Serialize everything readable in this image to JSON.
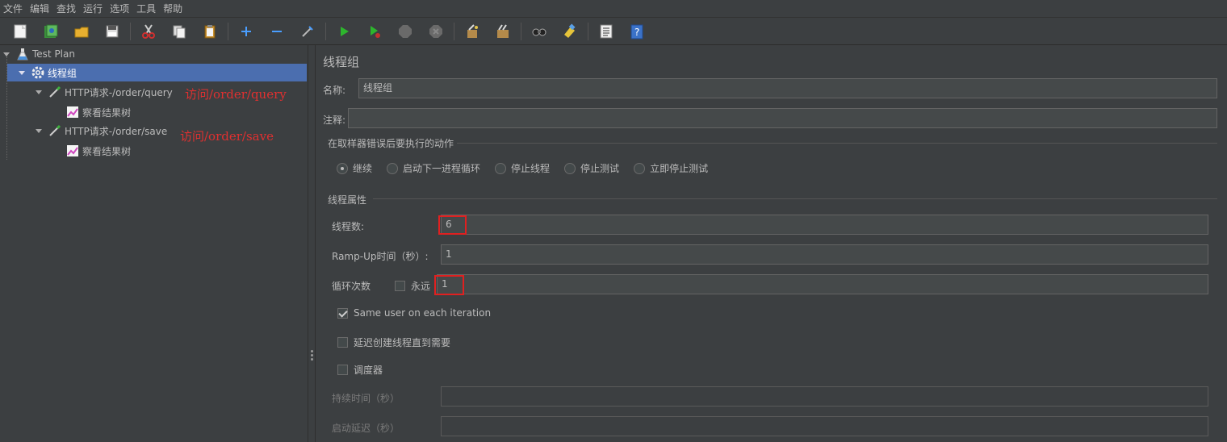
{
  "menu": [
    "文件",
    "编辑",
    "查找",
    "运行",
    "选项",
    "工具",
    "帮助"
  ],
  "toolbar": {
    "icons": [
      "new-icon",
      "templates-icon",
      "open-icon",
      "save-icon",
      "cut-icon",
      "copy-icon",
      "paste-icon",
      "expand-icon",
      "collapse-icon",
      "toggle-icon",
      "start-icon",
      "start-no-pause-icon",
      "stop-icon",
      "shutdown-icon",
      "clear-icon",
      "clear-all-icon",
      "search-icon",
      "reset-search-icon",
      "function-helper-icon",
      "help-icon"
    ]
  },
  "tree": {
    "items": [
      {
        "label": "Test Plan",
        "icon": "flask-icon"
      },
      {
        "label": "线程组",
        "icon": "gear-icon"
      },
      {
        "label": "HTTP请求-/order/query",
        "icon": "pipette-icon"
      },
      {
        "label": "察看结果树",
        "icon": "chart-icon"
      },
      {
        "label": "HTTP请求-/order/save",
        "icon": "pipette-icon"
      },
      {
        "label": "察看结果树",
        "icon": "chart-icon"
      }
    ],
    "annotations": [
      "访问/order/query",
      "访问/order/save"
    ]
  },
  "panel": {
    "title": "线程组",
    "name_label": "名称:",
    "name_value": "线程组",
    "comment_label": "注释:",
    "comment_value": "",
    "error_section": "在取样器错误后要执行的动作",
    "error_actions": [
      "继续",
      "启动下一进程循环",
      "停止线程",
      "停止测试",
      "立即停止测试"
    ],
    "selected_action": "继续",
    "thread_section": "线程属性",
    "threads_label": "线程数:",
    "threads_value": "6",
    "rampup_label": "Ramp-Up时间（秒）:",
    "rampup_value": "1",
    "loop_label": "循环次数",
    "forever_label": "永远",
    "loop_value": "1",
    "same_user_label": "Same user on each iteration",
    "delay_label": "延迟创建线程直到需要",
    "scheduler_label": "调度器",
    "duration_label": "持续时间（秒）",
    "startup_delay_label": "启动延迟（秒）"
  },
  "colors": {
    "selection": "#4b6eaf",
    "highlight": "#e02020"
  }
}
